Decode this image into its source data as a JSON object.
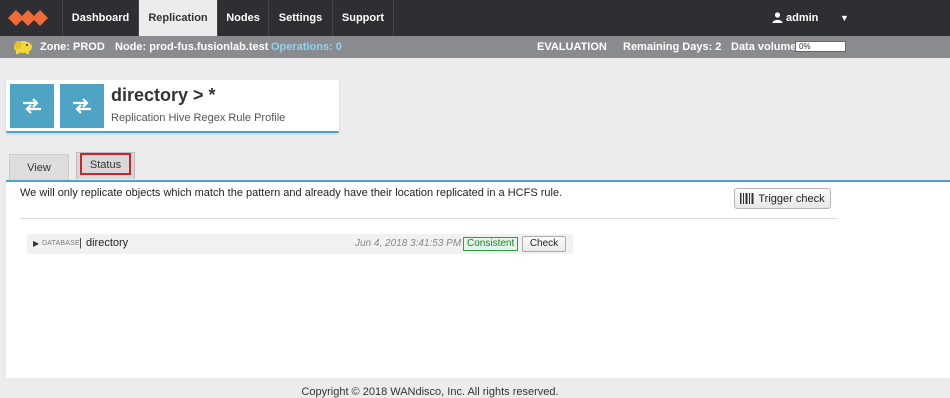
{
  "nav": {
    "tabs": [
      {
        "label": "Dashboard"
      },
      {
        "label": "Replication"
      },
      {
        "label": "Nodes"
      },
      {
        "label": "Settings"
      },
      {
        "label": "Support"
      }
    ],
    "active_tab": "Replication",
    "user": "admin",
    "user_menu_icon": "chevron-down-icon"
  },
  "statusbar": {
    "zone": "Zone: PROD",
    "node": "Node: prod-fus.fusionlab.test",
    "operations": "Operations: 0",
    "evaluation": "EVALUATION",
    "remaining": "Remaining Days: 2",
    "data_volume_label": "Data volume:",
    "data_volume_value": "0%",
    "data_volume_fraction": 0
  },
  "header": {
    "title": "directory > *",
    "subtitle": "Replication Hive Regex Rule Profile"
  },
  "tabs": {
    "view": "View",
    "status": "Status"
  },
  "content": {
    "info": "We will only replicate objects which match the pattern and already have their location replicated in a HCFS rule.",
    "trigger_button": "Trigger check",
    "rows": [
      {
        "type": "DATABASE",
        "separator": "|",
        "name": "directory",
        "date": "Jun 4, 2018 3:41:53 PM",
        "status": "Consistent",
        "action": "Check"
      }
    ]
  },
  "footer": "Copyright © 2018 WANdisco, Inc. All rights reserved.",
  "colors": {
    "nav_bg": "#2e2f33",
    "status_bg": "#8a8b8f",
    "accent": "#4fa3c4",
    "logo": "#f06a3a",
    "consistent": "#2e9e4a",
    "tab_highlight": "#d0222f"
  }
}
